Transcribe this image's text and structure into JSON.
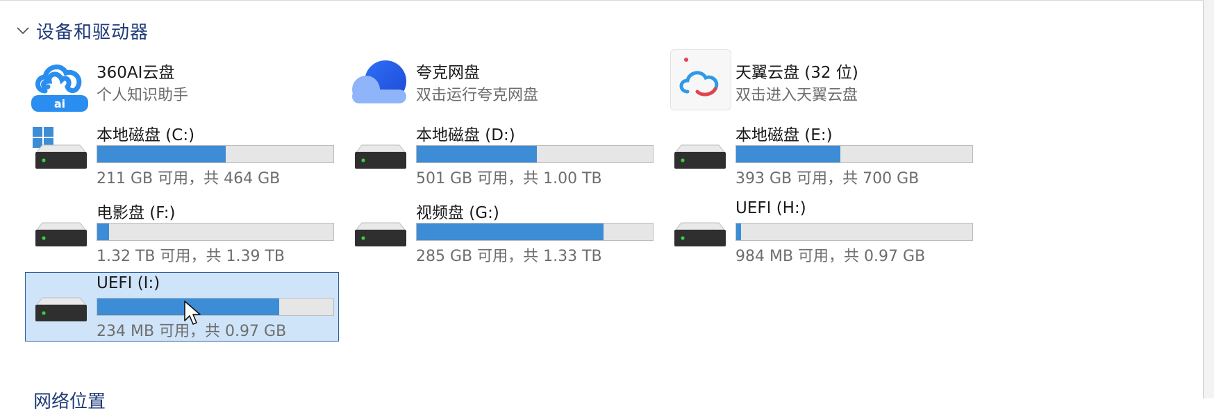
{
  "section": {
    "title": "设备和驱动器",
    "next_title": "网络位置"
  },
  "apps": [
    {
      "name": "360AI云盘",
      "subtitle": "个人知识助手",
      "icon": "cloud-ai-icon"
    },
    {
      "name": "夸克网盘",
      "subtitle": "双击运行夸克网盘",
      "icon": "quark-cloud-icon"
    },
    {
      "name": "天翼云盘 (32 位)",
      "subtitle": "双击进入天翼云盘",
      "icon": "tianyi-cloud-icon"
    }
  ],
  "drives": [
    {
      "name": "本地磁盘 (C:)",
      "usage": "211 GB 可用，共 464 GB",
      "used_fraction": 0.545,
      "icon": "windows-drive-icon"
    },
    {
      "name": "本地磁盘 (D:)",
      "usage": "501 GB 可用，共 1.00 TB",
      "used_fraction": 0.51,
      "icon": "drive-icon"
    },
    {
      "name": "本地磁盘 (E:)",
      "usage": "393 GB 可用，共 700 GB",
      "used_fraction": 0.44,
      "icon": "drive-icon"
    },
    {
      "name": "电影盘 (F:)",
      "usage": "1.32 TB 可用，共 1.39 TB",
      "used_fraction": 0.05,
      "icon": "drive-icon"
    },
    {
      "name": "视频盘 (G:)",
      "usage": "285 GB 可用，共 1.33 TB",
      "used_fraction": 0.79,
      "icon": "drive-icon"
    },
    {
      "name": "UEFI (H:)",
      "usage": "984 MB 可用，共 0.97 GB",
      "used_fraction": 0.02,
      "icon": "drive-icon"
    },
    {
      "name": "UEFI (I:)",
      "usage": "234 MB 可用，共 0.97 GB",
      "used_fraction": 0.77,
      "icon": "drive-icon",
      "selected": true
    }
  ],
  "colors": {
    "accent_bar": "#3c8dd6",
    "selection_bg": "#cfe4f9",
    "selection_border": "#2f5f9f",
    "header_text": "#1e3a78"
  }
}
